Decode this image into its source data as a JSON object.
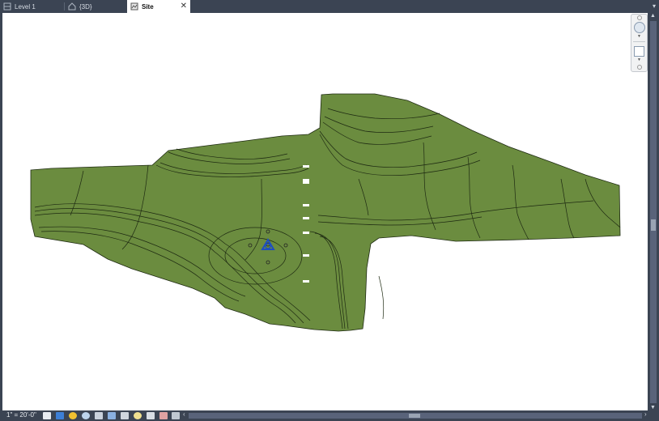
{
  "tabs": [
    {
      "label": "Level 1",
      "icon": "floor-plan-icon",
      "active": false
    },
    {
      "label": "{3D}",
      "icon": "house-3d-icon",
      "active": false
    },
    {
      "label": "Site",
      "icon": "site-plan-icon",
      "active": true,
      "close": "✕"
    }
  ],
  "window_controls": {
    "collapse_glyph": "▾"
  },
  "status": {
    "scale": "1\" = 20'-0\"",
    "icons": [
      "detail-level-icon",
      "visual-style-icon",
      "sun-path-icon",
      "shadows-icon",
      "crop-view-icon",
      "show-crop-icon",
      "unlock-3d-icon",
      "temporary-hide-icon",
      "reveal-hidden-icon",
      "temporary-view-properties-icon",
      "show-constraints-icon"
    ]
  },
  "navigation_bar": {
    "items": [
      "full-navigation-wheel-icon",
      "zoom-region-icon"
    ]
  },
  "colors": {
    "terrain": "#6b8c3f",
    "contour": "#1e2a12",
    "tab_active": "#ffffff",
    "chrome": "#3b4453",
    "marker": "#1f4fbf"
  },
  "scrollbars": {
    "up": "▲",
    "down": "▼",
    "left": "‹",
    "right": "›"
  }
}
